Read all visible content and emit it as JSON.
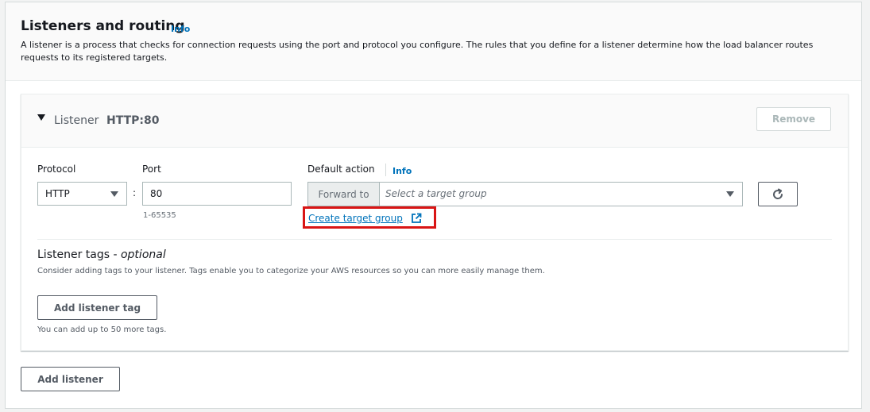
{
  "section": {
    "title": "Listeners and routing",
    "info_label": "Info",
    "description": "A listener is a process that checks for connection requests using the port and protocol you configure. The rules that you define for a listener determine how the load balancer routes requests to its registered targets."
  },
  "listener": {
    "name_label": "Listener",
    "protocol_port": "HTTP:80",
    "remove_label": "Remove",
    "protocol": {
      "label": "Protocol",
      "value": "HTTP"
    },
    "port": {
      "label": "Port",
      "value": "80",
      "hint": "1-65535"
    },
    "default_action": {
      "label": "Default action",
      "info_label": "Info",
      "prefix": "Forward to",
      "placeholder": "Select a target group",
      "create_link": "Create target group"
    },
    "tags": {
      "title": "Listener tags -",
      "title_optional": "optional",
      "description": "Consider adding tags to your listener. Tags enable you to categorize your AWS resources so you can more easily manage them.",
      "add_label": "Add listener tag",
      "hint": "You can add up to 50 more tags."
    }
  },
  "add_listener_label": "Add listener",
  "colors": {
    "link": "#0073bb",
    "highlight": "#d91515"
  },
  "icons": {
    "caret": "caret-down-icon",
    "refresh": "refresh-icon",
    "external": "external-link-icon"
  }
}
